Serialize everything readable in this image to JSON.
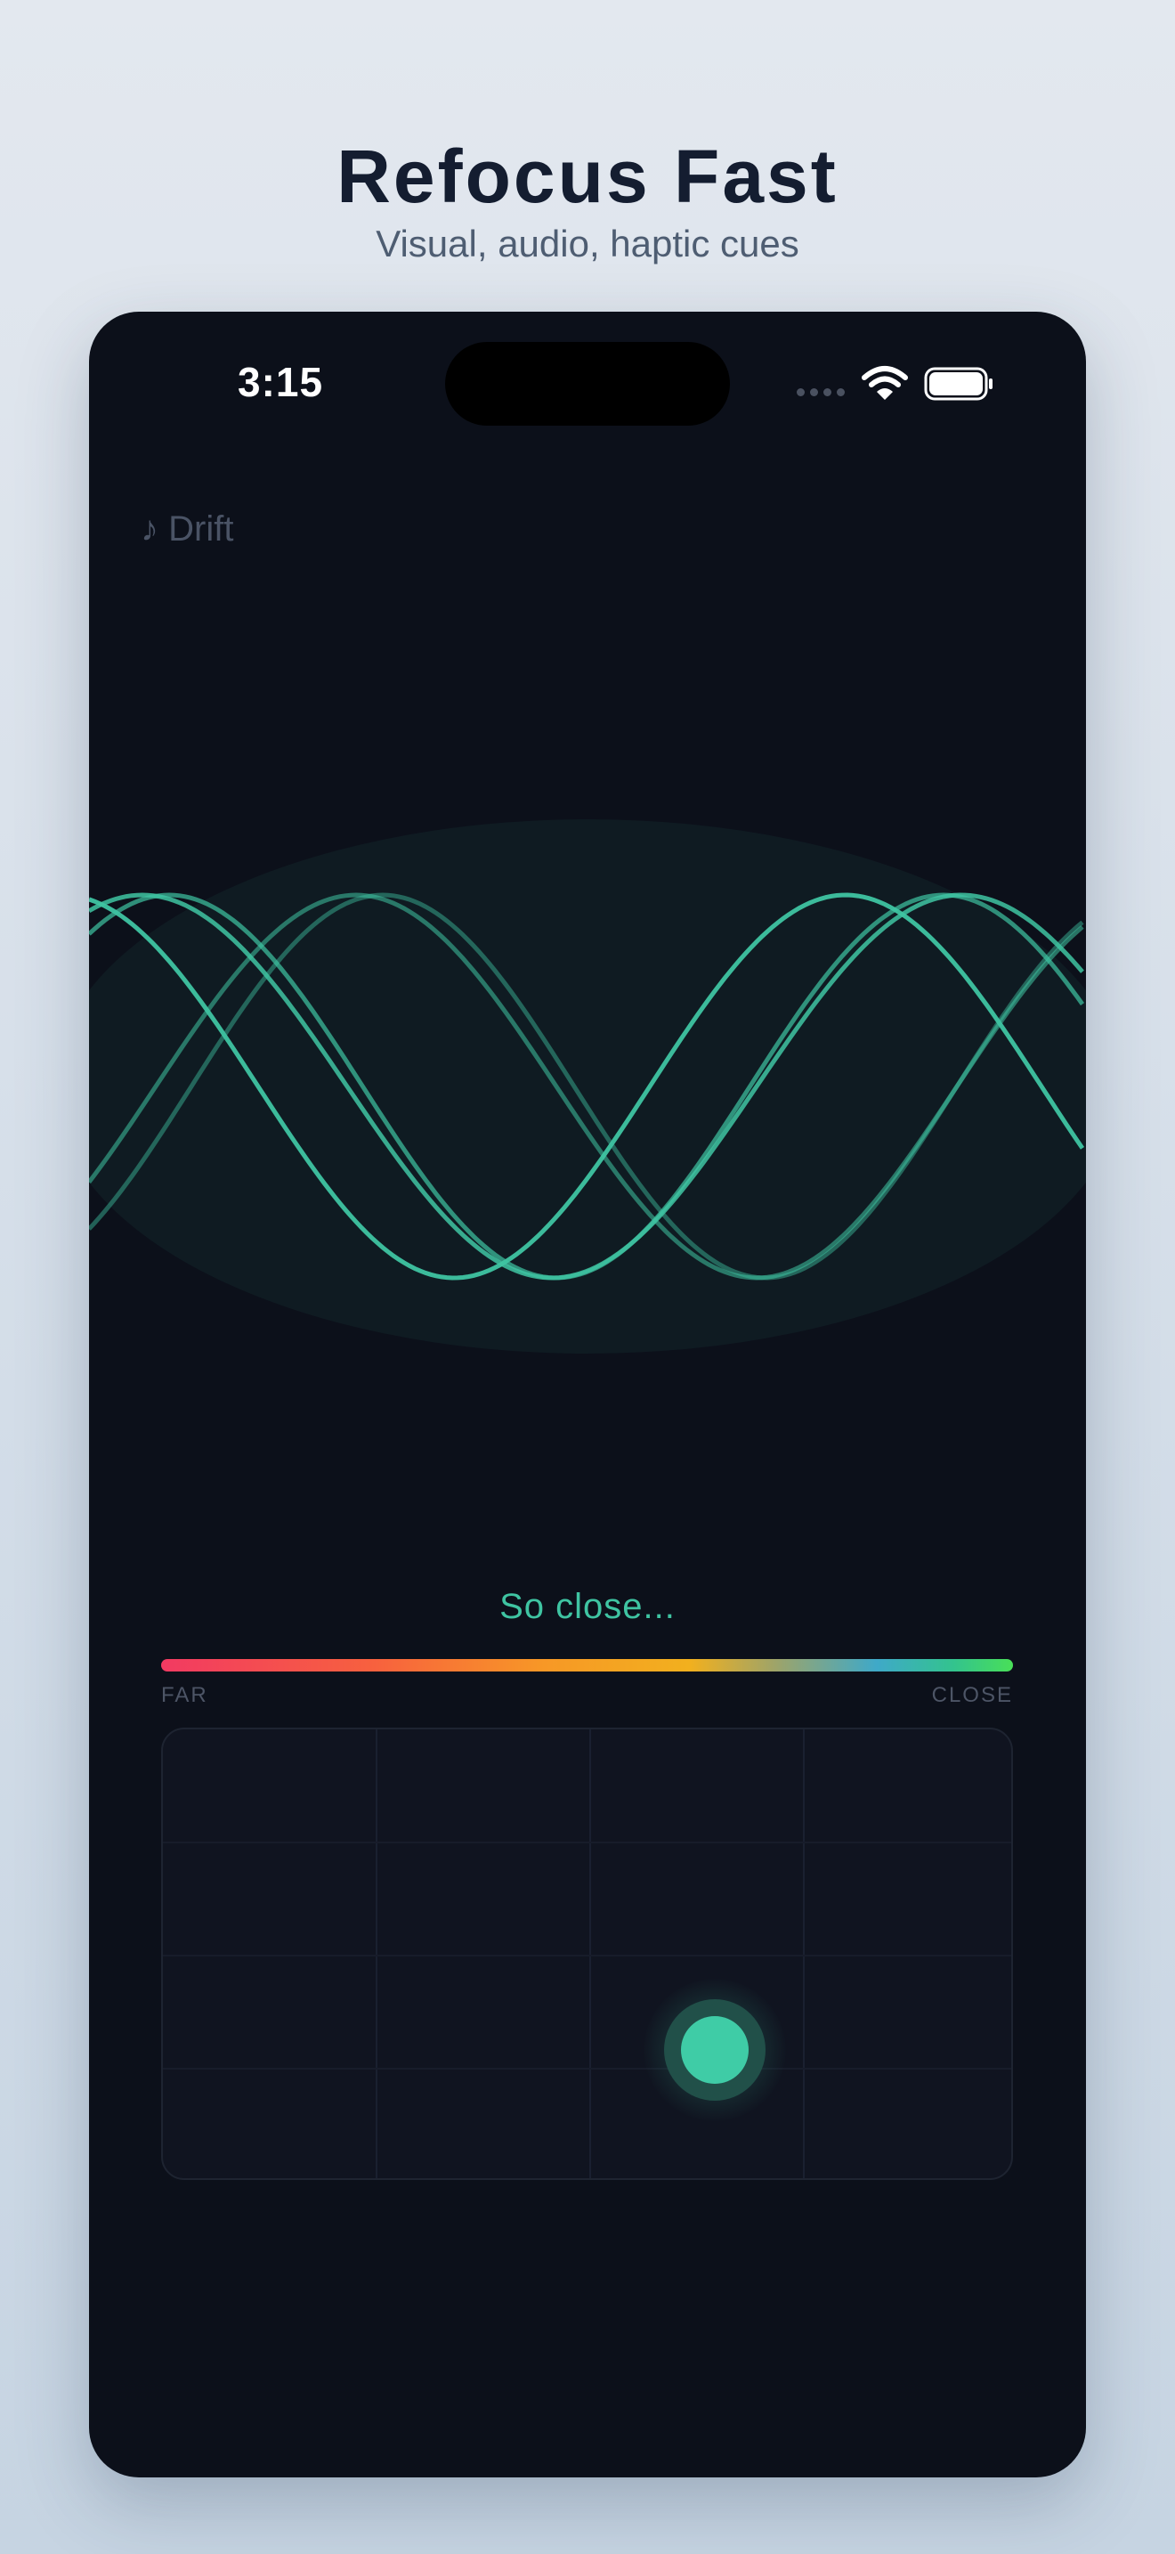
{
  "promo": {
    "title": "Refocus Fast",
    "subtitle": "Visual, audio, haptic cues"
  },
  "status_bar": {
    "time": "3:15",
    "signal_icon": "cellular-signal-icon",
    "wifi_icon": "wifi-icon",
    "battery_icon": "battery-icon"
  },
  "player": {
    "track": "♪ Drift",
    "visualizer_color": "#3fc4a2"
  },
  "feedback": {
    "hint": "So close...",
    "meter_far_label": "FAR",
    "meter_close_label": "CLOSE",
    "proximity_level": 0.8
  },
  "colors": {
    "accent": "#3fc4a2",
    "background": "#0c101a",
    "meter_start": "#f23a62",
    "meter_end": "#49df58"
  }
}
